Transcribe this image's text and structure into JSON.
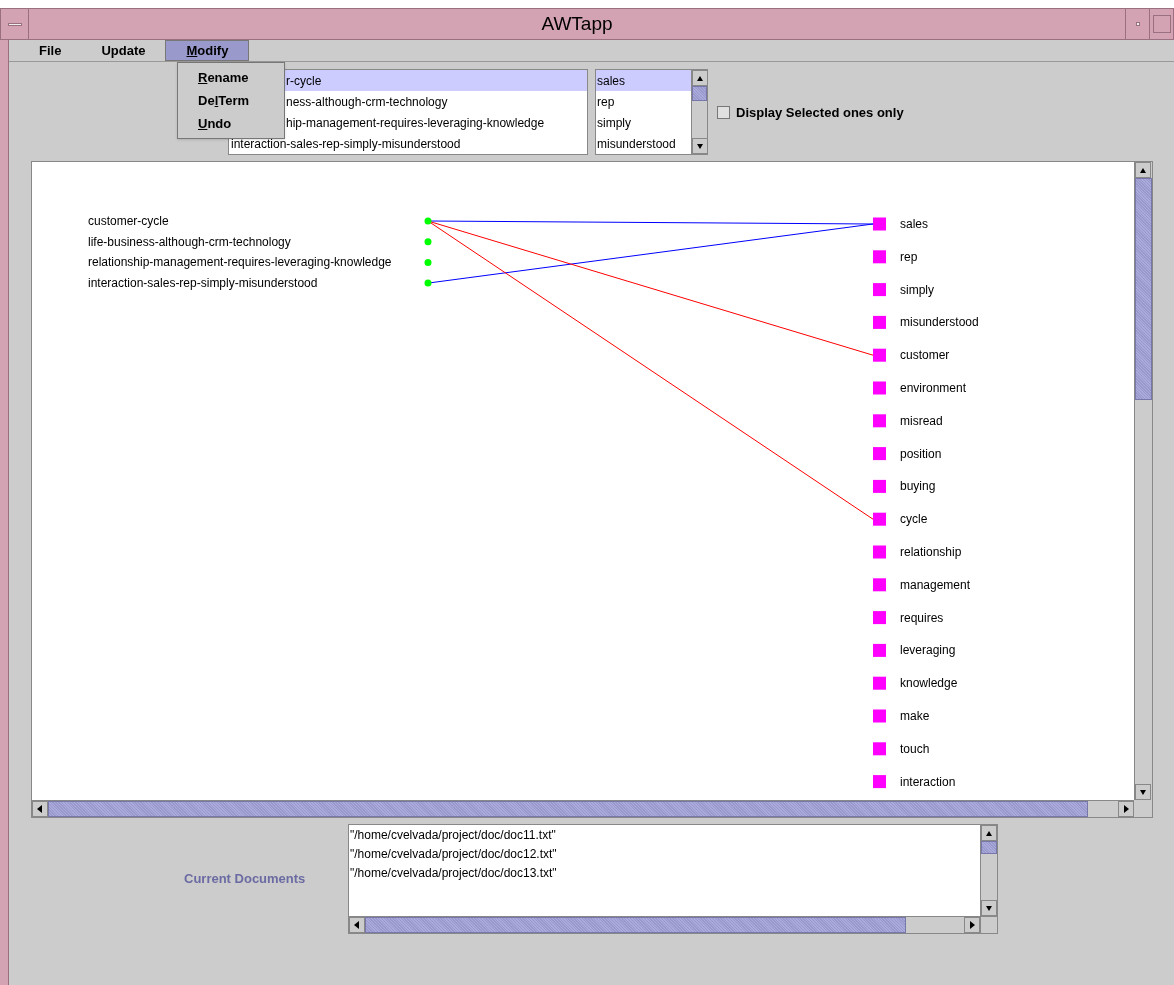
{
  "window": {
    "title": "AWTapp"
  },
  "menu": [
    {
      "label": "File",
      "selected": false
    },
    {
      "label": "Update",
      "selected": false
    },
    {
      "underlined": "M",
      "label_rest": "odify",
      "selected": true
    }
  ],
  "dropdown": [
    {
      "underlined": "R",
      "label_rest": "ename"
    },
    {
      "label_start": "De",
      "underlined": "l",
      "label_rest": "Term"
    },
    {
      "underlined": "U",
      "label_rest": "ndo"
    }
  ],
  "document_list": [
    {
      "text": "r-cycle",
      "selected": true,
      "covered": true
    },
    {
      "text": "ness-although-crm-technology",
      "selected": false,
      "covered": true
    },
    {
      "text": "hip-management-requires-leveraging-knowledge",
      "selected": false,
      "covered": true
    },
    {
      "text": "interaction-sales-rep-simply-misunderstood",
      "selected": false,
      "covered": false
    }
  ],
  "term_list": [
    {
      "text": "sales",
      "selected": true
    },
    {
      "text": "rep",
      "selected": false
    },
    {
      "text": "simply",
      "selected": false
    },
    {
      "text": "misunderstood",
      "selected": false
    }
  ],
  "display_selected_only": {
    "label": "Display Selected ones only",
    "checked": false
  },
  "graph": {
    "documents": [
      "customer-cycle",
      "life-business-although-crm-technology",
      "relationship-management-requires-leveraging-knowledge",
      "interaction-sales-rep-simply-misunderstood"
    ],
    "terms": [
      {
        "label": "sales",
        "links_by_document": [
          {
            "kind": "line",
            "color": "#0000ff"
          },
          {
            "kind": "none"
          },
          {
            "kind": "none"
          },
          {
            "kind": "line",
            "color": "#0000ff"
          }
        ]
      },
      {
        "label": "rep"
      },
      {
        "label": "simply"
      },
      {
        "label": "misunderstood"
      },
      {
        "label": "customer",
        "links_by_document": [
          {
            "kind": "line",
            "color": "#ff0000"
          }
        ]
      },
      {
        "label": "environment"
      },
      {
        "label": "misread"
      },
      {
        "label": "position"
      },
      {
        "label": "buying"
      },
      {
        "label": "cycle",
        "links_by_document": [
          {
            "kind": "line",
            "color": "#ff0000"
          }
        ]
      },
      {
        "label": "relationship"
      },
      {
        "label": "management"
      },
      {
        "label": "requires"
      },
      {
        "label": "leveraging"
      },
      {
        "label": "knowledge"
      },
      {
        "label": "make"
      },
      {
        "label": "touch"
      },
      {
        "label": "interaction"
      }
    ]
  },
  "current_documents": {
    "label": "Current Documents",
    "items": [
      "\"/home/cvelvada/project/doc/doc11.txt\"",
      "\"/home/cvelvada/project/doc/doc12.txt\"",
      "\"/home/cvelvada/project/doc/doc13.txt\""
    ]
  }
}
